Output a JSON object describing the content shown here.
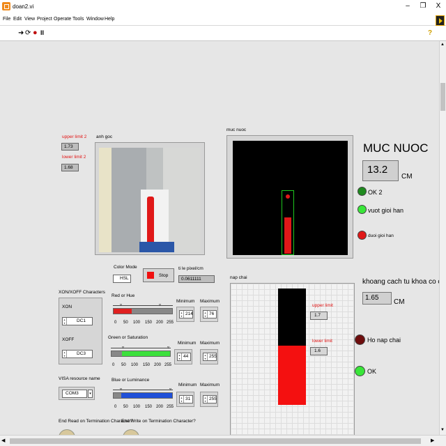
{
  "window": {
    "title": "doan2.vi",
    "buttons": {
      "minimize": "–",
      "maximize": "❐",
      "close": "X"
    }
  },
  "menu": [
    "File",
    "Edit",
    "View",
    "Project",
    "Operate",
    "Tools",
    "Window",
    "Help"
  ],
  "toolbar": {
    "run": "➜",
    "run_cont": "⟳",
    "abort": "●",
    "pause": "II",
    "help": "?"
  },
  "panel": {
    "upper_limit2": {
      "label": "upper limit 2",
      "value": "1.73"
    },
    "lower_limit2": {
      "label": "lower limit 2",
      "value": "1.68"
    },
    "anh_goc": {
      "label": "anh goc"
    },
    "muc_nuoc": {
      "label": "muc nuoc"
    },
    "mucnuoc_heading": "MUC NUOC",
    "mucnuoc_value": "13.2",
    "mucnuoc_unit": "CM",
    "leds": {
      "ok2": {
        "label": "OK 2",
        "color": "#1f8a1f"
      },
      "vuot": {
        "label": "vuot gioi han",
        "color": "#39e639"
      },
      "duoi": {
        "label": "duoi gioi han",
        "color": "#e01818"
      },
      "ho_nap": {
        "label": "Ho nap chai",
        "color": "#6e0d0d"
      },
      "ok": {
        "label": "OK",
        "color": "#39e639"
      }
    },
    "color_mode": {
      "label": "Color Mode",
      "value": "HSL"
    },
    "stop": {
      "label": "Stop"
    },
    "ti_le": {
      "label": "ti  le pixel/cm",
      "value": "0.0611111"
    },
    "nap_chai": {
      "label": "nap chai"
    },
    "upper_limit": {
      "label": "upper limit",
      "value": "1.7"
    },
    "lower_limit": {
      "label": "lower limit",
      "value": "1.6"
    },
    "khoang_cach": {
      "label": "khoang cach tu khoa co chai d",
      "value": "1.65",
      "unit": "CM"
    },
    "xon_xoff": {
      "label": "XON/XOFF Characters",
      "xon_label": "XON",
      "xon_value": "DC1",
      "xoff_label": "XOFF",
      "xoff_value": "DC3"
    },
    "visa": {
      "label": "VISA resource name",
      "value": "COM3"
    },
    "slider_ticks": [
      "0",
      "50",
      "100",
      "150",
      "200",
      "255"
    ],
    "hue": {
      "label": "Red or Hue",
      "min_label": "Minimum",
      "max_label": "Maximum",
      "min": "214",
      "max": "76",
      "color": "#e02020"
    },
    "sat": {
      "label": "Green or Saturation",
      "min_label": "Minimum",
      "max_label": "Maximum",
      "min": "44",
      "max": "255",
      "color": "#3ce03c"
    },
    "lum": {
      "label": "Blue or Luminance",
      "min_label": "Minimum",
      "max_label": "Maximum",
      "min": "31",
      "max": "255",
      "color": "#2050d8"
    },
    "end_read": "End Read on Termination Character?",
    "end_write": "End Write on Termination Character?"
  }
}
